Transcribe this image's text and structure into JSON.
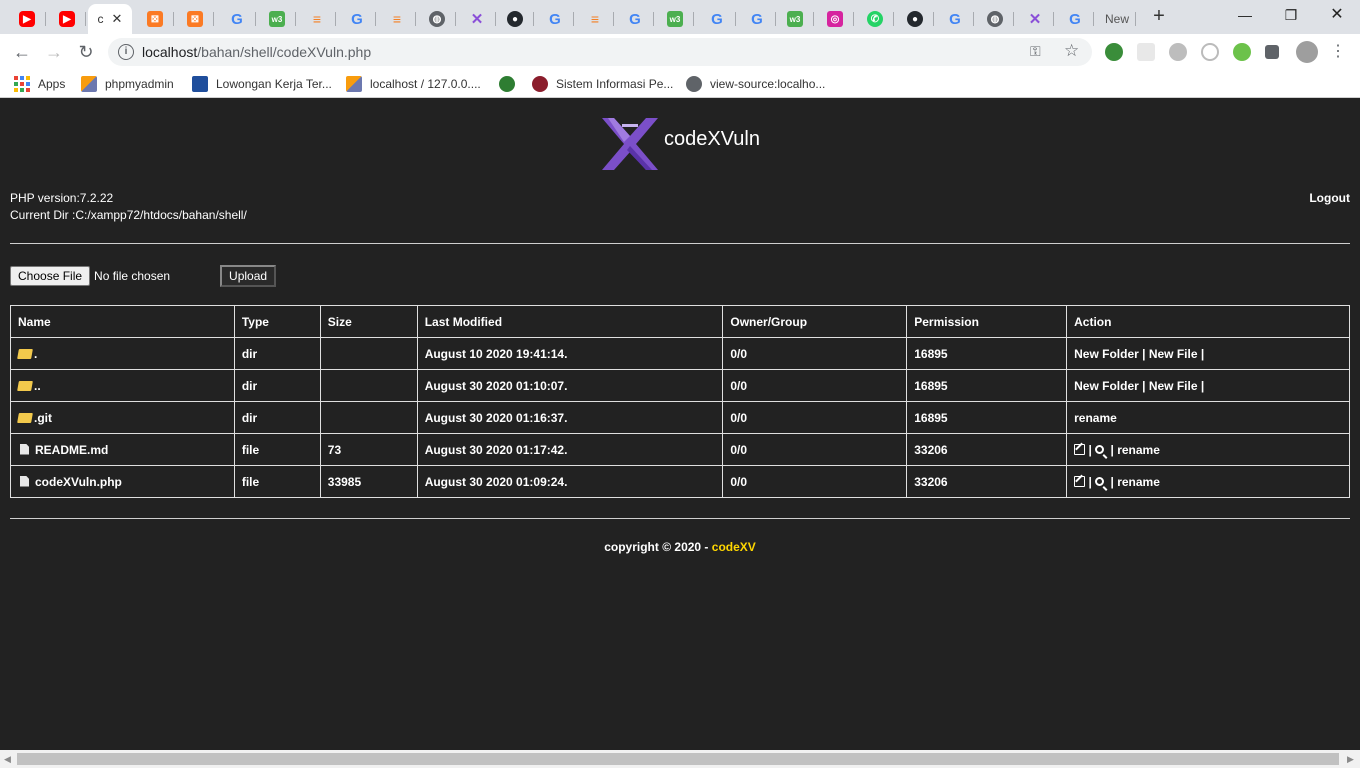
{
  "browser": {
    "tabs": [
      {
        "icon": "youtube-icon",
        "color": "#ff0000"
      },
      {
        "icon": "youtube-icon",
        "color": "#ff0000"
      },
      {
        "icon": "codexvuln-favicon",
        "label": "c",
        "active": true
      },
      {
        "icon": "xampp-icon",
        "color": "#fb7a24"
      },
      {
        "icon": "xampp-icon",
        "color": "#fb7a24"
      },
      {
        "icon": "google-icon"
      },
      {
        "icon": "w3schools-icon",
        "color": "#4caf50"
      },
      {
        "icon": "stackoverflow-icon",
        "color": "#f48024"
      },
      {
        "icon": "google-icon"
      },
      {
        "icon": "stackoverflow-icon",
        "color": "#f48024"
      },
      {
        "icon": "globe-icon"
      },
      {
        "icon": "codexvuln-icon",
        "color": "#8a4fd8"
      },
      {
        "icon": "github-icon"
      },
      {
        "icon": "google-icon"
      },
      {
        "icon": "stackoverflow-icon",
        "color": "#f48024"
      },
      {
        "icon": "google-icon"
      },
      {
        "icon": "w3schools-icon",
        "color": "#4caf50"
      },
      {
        "icon": "google-icon"
      },
      {
        "icon": "google-icon"
      },
      {
        "icon": "w3schools-icon",
        "color": "#4caf50"
      },
      {
        "icon": "instagram-icon",
        "color": "#d6249f"
      },
      {
        "icon": "whatsapp-icon",
        "color": "#25d366"
      },
      {
        "icon": "github-icon"
      },
      {
        "icon": "google-icon"
      },
      {
        "icon": "globe-icon"
      },
      {
        "icon": "codexvuln-icon",
        "color": "#8a4fd8"
      },
      {
        "icon": "google-icon"
      },
      {
        "icon": "new-tab",
        "label": "New"
      }
    ],
    "url_host": "localhost",
    "url_path": "/bahan/shell/codeXVuln.php",
    "bookmarks": [
      {
        "icon": "apps-icon",
        "label": "Apps"
      },
      {
        "icon": "phpmyadmin-icon",
        "label": "phpmyadmin"
      },
      {
        "icon": "job-icon",
        "label": "Lowongan Kerja Ter..."
      },
      {
        "icon": "phpmyadmin-icon",
        "label": "localhost / 127.0.0...."
      },
      {
        "icon": "university-icon",
        "label": ""
      },
      {
        "icon": "sistem-icon",
        "label": "Sistem Informasi Pe..."
      },
      {
        "icon": "globe-icon",
        "label": "view-source:localho..."
      }
    ]
  },
  "page": {
    "brand": "codeXVuln",
    "php_version_label": "PHP version:7.2.22",
    "current_dir_label": "Current Dir",
    "current_dir_value": " :C:/xampp72/htdocs/bahan/shell/",
    "logout": "Logout",
    "upload": {
      "choose_label": "Choose File",
      "no_file": "No file chosen",
      "upload_label": "Upload"
    },
    "table": {
      "headers": [
        "Name",
        "Type",
        "Size",
        "Last Modified",
        "Owner/Group",
        "Permission",
        "Action"
      ],
      "rows": [
        {
          "kind": "dir",
          "name": ".",
          "type": "dir",
          "size": "",
          "modified": "August 10 2020 19:41:14.",
          "owner": "0/0",
          "perm": "16895",
          "action_a": "New Folder",
          "action_b": "New File",
          "sep1": " | ",
          "sep2": " |"
        },
        {
          "kind": "dir",
          "name": "..",
          "type": "dir",
          "size": "",
          "modified": "August 30 2020 01:10:07.",
          "owner": "0/0",
          "perm": "16895",
          "action_a": "New Folder",
          "action_b": "New File",
          "sep1": " | ",
          "sep2": " |"
        },
        {
          "kind": "dir",
          "name": ".git",
          "type": "dir",
          "size": "",
          "modified": "August 30 2020 01:16:37.",
          "owner": "0/0",
          "perm": "16895",
          "action_rename": "rename"
        },
        {
          "kind": "file",
          "name": "README.md",
          "type": "file",
          "size": "73",
          "modified": "August 30 2020 01:17:42.",
          "owner": "0/0",
          "perm": "33206",
          "sep": " | ",
          "action_rename": "rename"
        },
        {
          "kind": "file",
          "name": "codeXVuln.php",
          "type": "file",
          "size": "33985",
          "modified": "August 30 2020 01:09:24.",
          "owner": "0/0",
          "perm": "33206",
          "sep": " | ",
          "action_rename": "rename"
        }
      ]
    },
    "footer": {
      "text": "copyright © 2020 - ",
      "highlight": "codeXV",
      "highlight_color": "#ffd700"
    }
  }
}
